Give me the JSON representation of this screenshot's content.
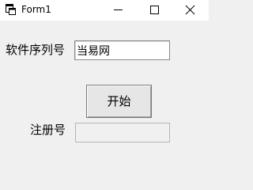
{
  "window": {
    "title": "Form1"
  },
  "form": {
    "serial_label": "软件序列号",
    "serial_value": "当易网",
    "start_button_label": "开始",
    "registration_label": "注册号",
    "registration_value": ""
  }
}
